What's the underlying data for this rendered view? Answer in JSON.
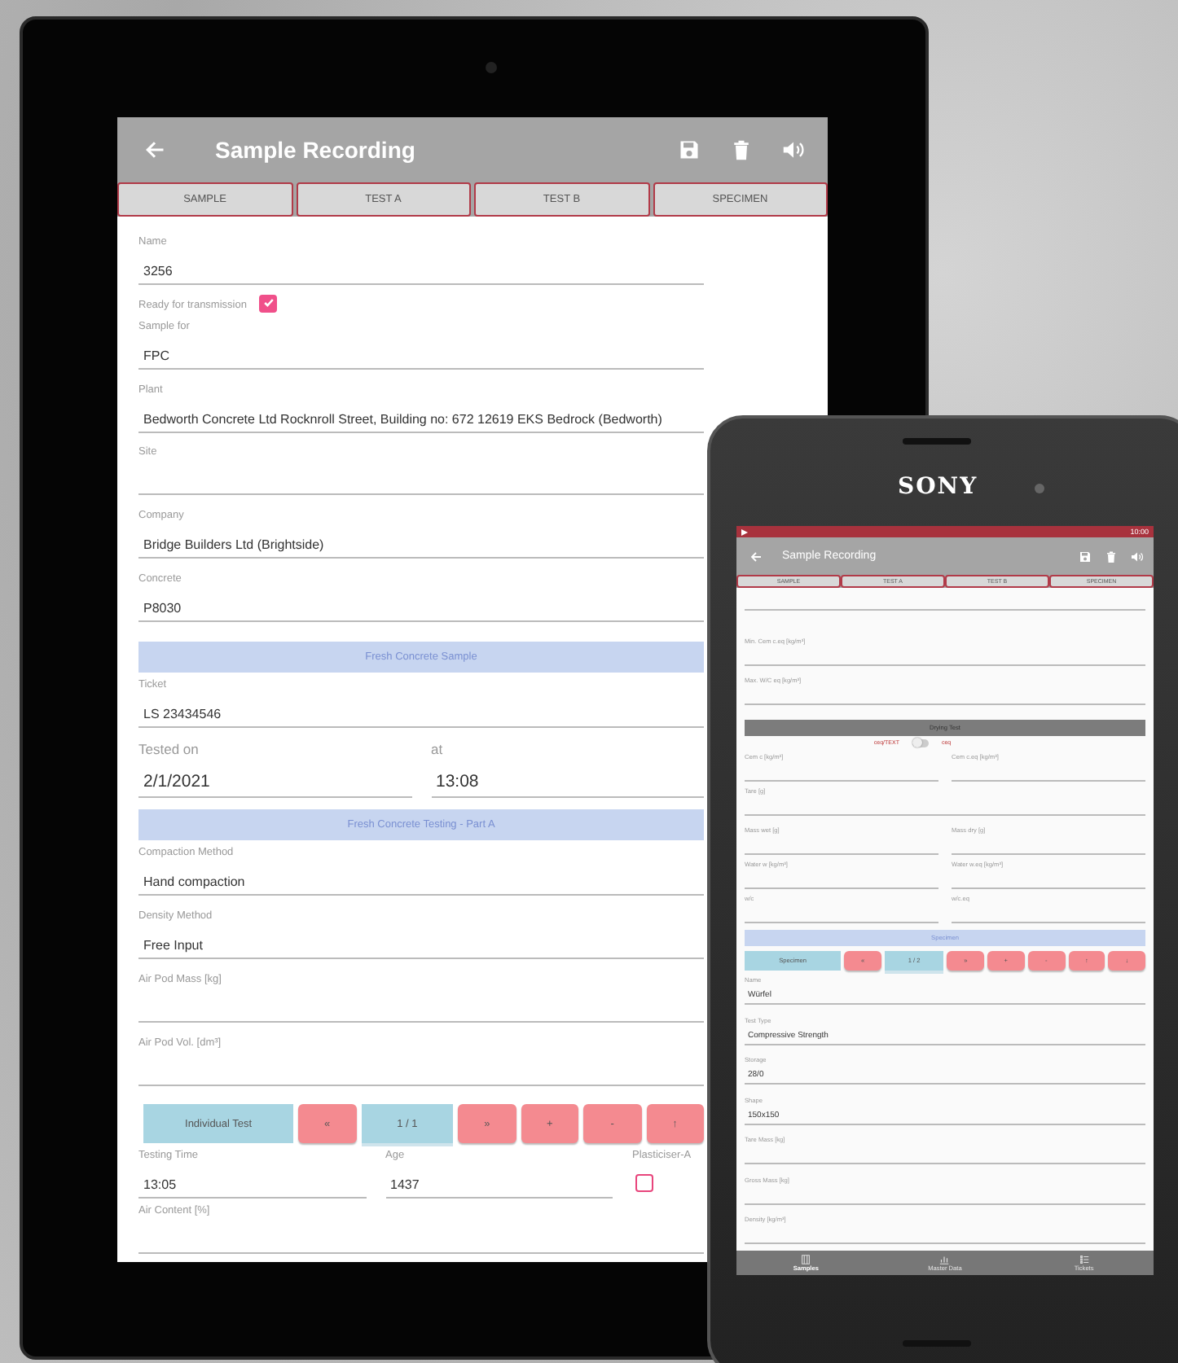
{
  "tablet": {
    "app_bar": {
      "title": "Sample Recording"
    },
    "tabs": [
      "SAMPLE",
      "TEST A",
      "TEST B",
      "SPECIMEN"
    ],
    "form": [
      {
        "kind": "field",
        "label": "Name",
        "value": "3256"
      },
      {
        "kind": "checkbox",
        "label": "Ready for transmission",
        "checked": true
      },
      {
        "kind": "field",
        "label": "Sample for",
        "value": "FPC"
      },
      {
        "kind": "field",
        "label": "Plant",
        "value": "Bedworth Concrete Ltd Rocknroll Street, Building no: 672 12619 EKS Bedrock (Bedworth)"
      },
      {
        "kind": "field",
        "label": "Site"
      },
      {
        "kind": "field",
        "label": "Company",
        "value": "Bridge Builders Ltd (Brightside)"
      },
      {
        "kind": "field",
        "label": "Concrete",
        "value": "P8030"
      },
      {
        "kind": "banner",
        "label": "Fresh Concrete Sample"
      },
      {
        "kind": "field",
        "label": "Ticket",
        "value": "LS 23434546"
      },
      {
        "kind": "row",
        "large": true,
        "items": [
          {
            "kind": "field",
            "label": "Tested on",
            "value": "2/1/2021"
          },
          {
            "kind": "field",
            "label": "at",
            "value": "13:08"
          }
        ]
      },
      {
        "kind": "banner",
        "label": "Fresh Concrete Testing - Part A"
      },
      {
        "kind": "field",
        "label": "Compaction Method",
        "value": "Hand compaction"
      },
      {
        "kind": "field",
        "label": "Density Method",
        "value": "Free Input"
      },
      {
        "kind": "field",
        "label": "Air Pod Mass [kg]"
      },
      {
        "kind": "field",
        "label": "Air Pod Vol. [dm³]"
      },
      {
        "kind": "buttons",
        "items": [
          {
            "kind": "tag",
            "label": "Individual Test"
          },
          {
            "kind": "action",
            "label": "«"
          },
          {
            "kind": "counter",
            "label": "1 / 1"
          },
          {
            "kind": "action",
            "label": "»"
          },
          {
            "kind": "action",
            "label": "+"
          },
          {
            "kind": "action",
            "label": "-"
          },
          {
            "kind": "action",
            "label": "↑"
          }
        ]
      },
      {
        "kind": "row",
        "items": [
          {
            "kind": "field",
            "label": "Testing Time",
            "value": "13:05"
          },
          {
            "kind": "field",
            "label": "Age",
            "value": "1437"
          },
          {
            "kind": "checkbox",
            "label": "Plasticiser-A",
            "checked": false
          }
        ]
      },
      {
        "kind": "field",
        "label": "Air Content [%]"
      }
    ]
  },
  "phone": {
    "brand": "SONY",
    "status_bar": {
      "time": "10:00"
    },
    "app_bar": {
      "title": "Sample Recording"
    },
    "tabs": [
      "SAMPLE",
      "TEST A",
      "TEST B",
      "SPECIMEN"
    ],
    "form": [
      {
        "kind": "field"
      },
      {
        "kind": "field",
        "label": "Min. Cem c.eq [kg/m³]"
      },
      {
        "kind": "field",
        "label": "Max. W/C eq [kg/m³]"
      },
      {
        "kind": "header",
        "label": "Drying Test"
      },
      {
        "kind": "toggle",
        "left": "ceq/TEXT",
        "right": "ceq",
        "on": false
      },
      {
        "kind": "row",
        "items": [
          {
            "kind": "field",
            "label": "Cem c [kg/m³]"
          },
          {
            "kind": "field",
            "label": "Cem c.eq [kg/m³]"
          }
        ]
      },
      {
        "kind": "field",
        "label": "Tare [g]"
      },
      {
        "kind": "row",
        "items": [
          {
            "kind": "field",
            "label": "Mass wet [g]"
          },
          {
            "kind": "field",
            "label": "Mass dry [g]"
          }
        ]
      },
      {
        "kind": "row",
        "items": [
          {
            "kind": "field",
            "label": "Water w [kg/m³]"
          },
          {
            "kind": "field",
            "label": "Water w.eq [kg/m³]"
          }
        ]
      },
      {
        "kind": "row",
        "items": [
          {
            "kind": "field",
            "label": "w/c"
          },
          {
            "kind": "field",
            "label": "w/c.eq"
          }
        ]
      },
      {
        "kind": "banner",
        "label": "Specimen"
      },
      {
        "kind": "buttons",
        "items": [
          {
            "kind": "tag",
            "label": "Specimen"
          },
          {
            "kind": "action",
            "label": "«"
          },
          {
            "kind": "counter",
            "label": "1 / 2"
          },
          {
            "kind": "action",
            "label": "»"
          },
          {
            "kind": "action",
            "label": "+"
          },
          {
            "kind": "action",
            "label": "-"
          },
          {
            "kind": "action",
            "label": "↑"
          },
          {
            "kind": "action",
            "label": "↓"
          }
        ]
      },
      {
        "kind": "field",
        "label": "Name",
        "value": "Würfel"
      },
      {
        "kind": "field",
        "label": "Test Type",
        "value": "Compressive Strength"
      },
      {
        "kind": "field",
        "label": "Storage",
        "value": "28/0"
      },
      {
        "kind": "field",
        "label": "Shape",
        "value": "150x150"
      },
      {
        "kind": "field",
        "label": "Tare Mass [kg]"
      },
      {
        "kind": "field",
        "label": "Gross Mass [kg]"
      },
      {
        "kind": "field",
        "label": "Density [kg/m³]"
      }
    ],
    "bottom_nav": [
      {
        "label": "Samples",
        "selected": true
      },
      {
        "label": "Master Data",
        "selected": false
      },
      {
        "label": "Tickets",
        "selected": false
      }
    ]
  }
}
